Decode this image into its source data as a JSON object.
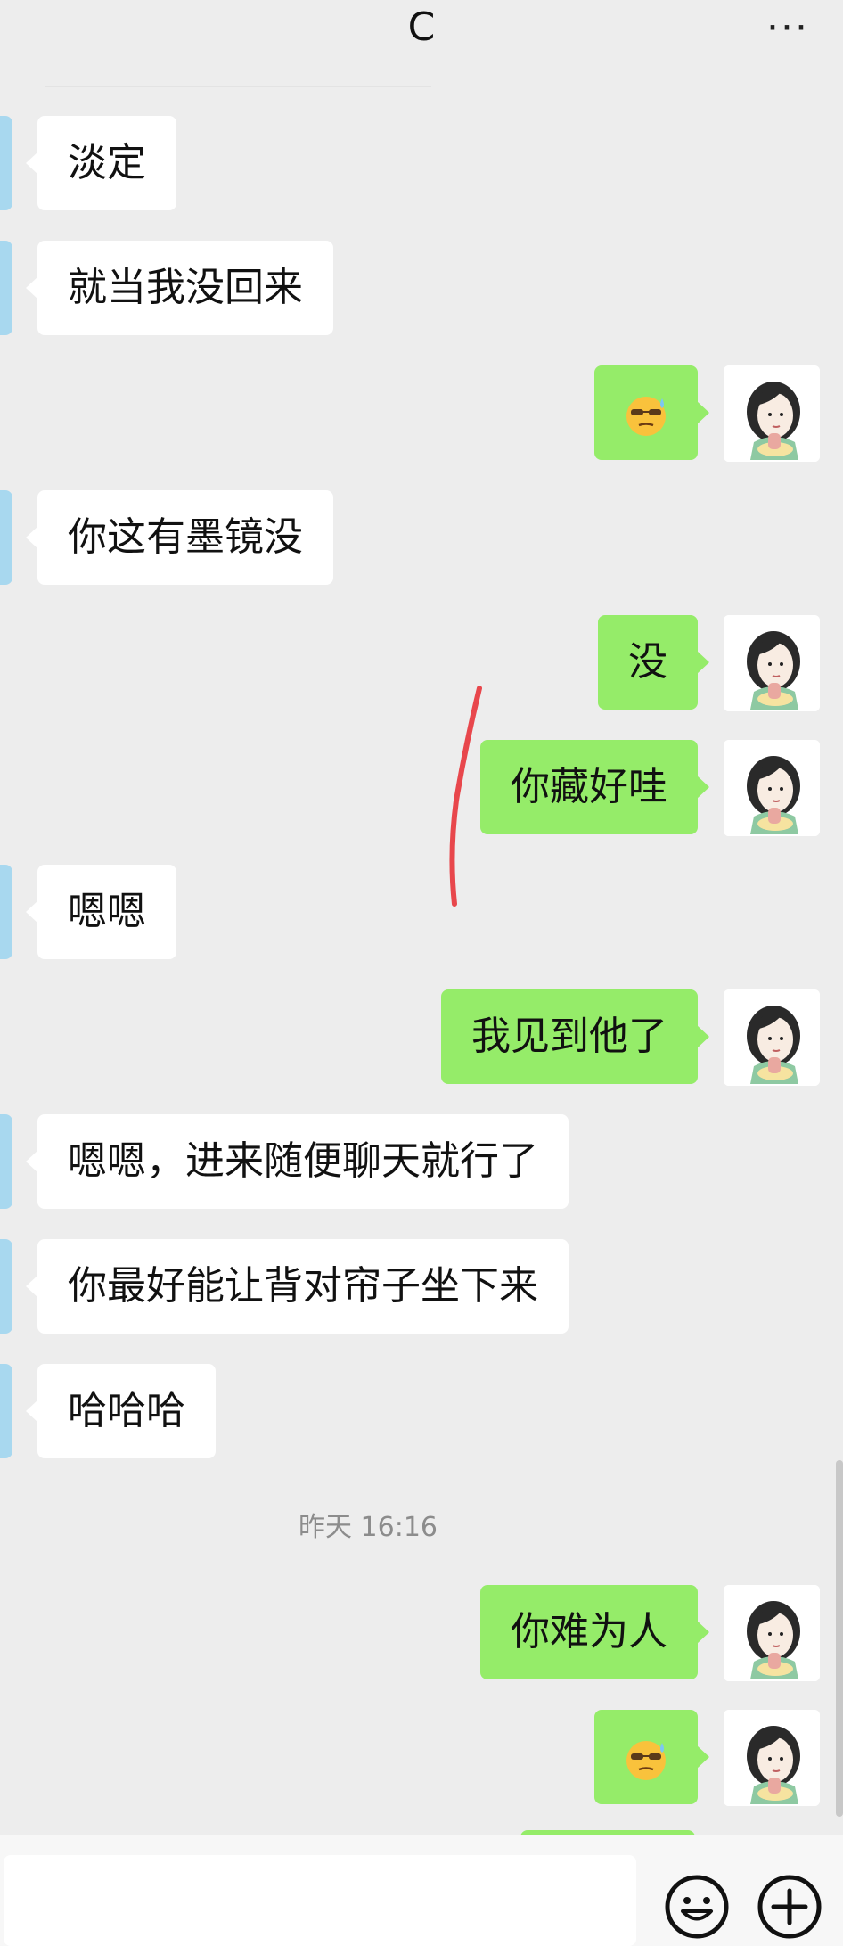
{
  "header": {
    "title": "C",
    "more_icon": "more-horizontal-icon"
  },
  "messages": [
    {
      "side": "in",
      "text": "淡定"
    },
    {
      "side": "in",
      "text": "就当我没回来"
    },
    {
      "side": "out",
      "emoji": "sweat-sunglasses-emoji"
    },
    {
      "side": "in",
      "text": "你这有墨镜没"
    },
    {
      "side": "out",
      "text": "没"
    },
    {
      "side": "out",
      "text": "你藏好哇"
    },
    {
      "side": "in",
      "text": "嗯嗯"
    },
    {
      "side": "out",
      "text": "我见到他了"
    },
    {
      "side": "in",
      "text": "嗯嗯，进来随便聊天就行了"
    },
    {
      "side": "in",
      "text": "你最好能让背对帘子坐下来"
    },
    {
      "side": "in",
      "text": "哈哈哈"
    },
    {
      "side": "out",
      "text": "你难为人"
    },
    {
      "side": "out",
      "emoji": "sweat-sunglasses-emoji"
    }
  ],
  "timestamp": "昨天 16:16",
  "input_bar": {
    "placeholder": "",
    "emoji_icon": "emoji-icon",
    "plus_icon": "plus-icon"
  },
  "annotation_color": "#e8474c",
  "colors": {
    "outgoing_bubble": "#95ec69",
    "incoming_bubble": "#ffffff",
    "background": "#ededed"
  }
}
